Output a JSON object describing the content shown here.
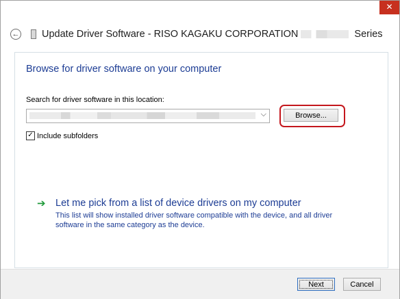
{
  "window": {
    "title_prefix": "Update Driver Software - RISO KAGAKU CORPORATION",
    "title_suffix": "Series",
    "close_glyph": "✕"
  },
  "main": {
    "heading": "Browse for driver software on your computer",
    "search_label": "Search for driver software in this location:",
    "path_value": "",
    "browse_label": "Browse...",
    "include_subfolders_label": "Include subfolders",
    "include_subfolders_checked": true,
    "pick_title": "Let me pick from a list of device drivers on my computer",
    "pick_description": "This list will show installed driver software compatible with the device, and all driver software in the same category as the device."
  },
  "footer": {
    "next_label": "Next",
    "cancel_label": "Cancel"
  },
  "icons": {
    "back": "back-arrow-icon",
    "device": "device-icon",
    "pick_arrow": "green-arrow-icon",
    "dropdown": "chevron-down-icon"
  },
  "colors": {
    "link": "#1c3c94",
    "close_button": "#c7301f",
    "highlight": "#c4161c",
    "arrow": "#1f9a3a"
  }
}
